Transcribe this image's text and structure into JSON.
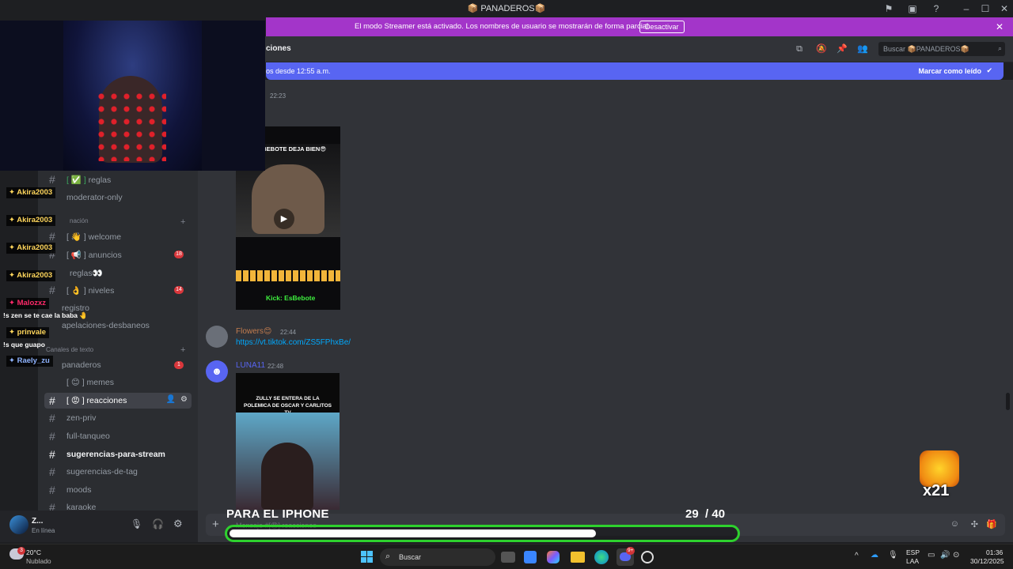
{
  "window": {
    "title": "📦 PANADEROS📦"
  },
  "streamer_banner": {
    "text": "El modo Streamer está activado. Los nombres de usuario se mostrarán de forma parcial.",
    "button": "Desactivar"
  },
  "channel_header": {
    "name": "ciones",
    "search_placeholder": "Buscar 📦PANADEROS📦"
  },
  "new_messages": {
    "text": "os desde 12:55 a.m.",
    "mark_read": "Marcar como leído"
  },
  "sidebar": {
    "channels_top": [
      {
        "label": "reglas",
        "prefix": "[ ✅ ]"
      },
      {
        "label": "moderator-only",
        "prefix": ""
      }
    ],
    "category_1": "nación",
    "channels_1": [
      {
        "label": "welcome",
        "prefix": "[ 👋 ]",
        "badge": ""
      },
      {
        "label": "anuncios",
        "prefix": "[ 📢 ]",
        "badge": "18"
      },
      {
        "label": "reglas👀",
        "prefix": "",
        "badge": ""
      },
      {
        "label": "niveles",
        "prefix": "[ 👌 ]",
        "badge": "14"
      },
      {
        "label": "registro",
        "prefix": "",
        "badge": ""
      },
      {
        "label": "apelaciones-desbaneos",
        "prefix": "",
        "badge": ""
      }
    ],
    "category_2": "Canales de texto",
    "channels_2": [
      {
        "label": "panaderos",
        "prefix": "",
        "badge": "1"
      },
      {
        "label": "memes",
        "prefix": "[ 😊 ]",
        "badge": ""
      },
      {
        "label": "reacciones",
        "prefix": "[ 😡 ]",
        "badge": ""
      },
      {
        "label": "zen-priv",
        "prefix": "",
        "badge": ""
      },
      {
        "label": "full-tanqueo",
        "prefix": "",
        "badge": ""
      },
      {
        "label": "sugerencias-para-stream",
        "prefix": "",
        "badge": ""
      },
      {
        "label": "sugerencias-de-tag",
        "prefix": "",
        "badge": ""
      },
      {
        "label": "moods",
        "prefix": "",
        "badge": ""
      },
      {
        "label": "karaoke",
        "prefix": "",
        "badge": ""
      }
    ]
  },
  "user_area": {
    "name": "Z...",
    "status": "En línea"
  },
  "messages": [
    {
      "time": "22:23"
    },
    {
      "author": "Flowers😊",
      "time": "22:44",
      "link": "https://vt.tiktok.com/ZS5FPhxBe/"
    },
    {
      "author": "LUNA11",
      "time": "22:48"
    }
  ],
  "media_1": {
    "caption": "IDO BEBOTE DEJA BIEN😎",
    "kick": "Kick: EsBebote"
  },
  "media_2": {
    "caption": "ZULLY SE ENTERA DE LA POLEMICA DE OSCAR Y CARLITOS TV"
  },
  "chat_overlay": [
    {
      "name": "Akira2003",
      "color": "#ffd65c"
    },
    {
      "name": "Akira2003",
      "color": "#ffd65c"
    },
    {
      "name": "Akira2003",
      "color": "#ffd65c"
    },
    {
      "name": "Akira2003",
      "color": "#ffd65c"
    },
    {
      "name": "Malozxz",
      "color": "#ff2a6a",
      "msg": "!s zen se te cae la baba 🤚"
    },
    {
      "name": "prinvale",
      "color": "#ffd65c",
      "msg": "!s que guapo"
    },
    {
      "name": "Raely_zu",
      "color": "#8fb3ff"
    }
  ],
  "goal": {
    "title": "PARA EL IPHONE",
    "current": "29",
    "total": "/ 40",
    "progress": 0.725
  },
  "combo": {
    "text": "x21"
  },
  "composer": {
    "placeholder": "Mensaje #[😡] reacciones"
  },
  "taskbar": {
    "weather_temp": "20°C",
    "weather_desc": "Nublado",
    "search": "Buscar",
    "lang1": "ESP",
    "lang2": "LAA",
    "time": "01:36",
    "date": "30/12/2025",
    "weather_badge": "3",
    "discord_badge": "9+"
  }
}
